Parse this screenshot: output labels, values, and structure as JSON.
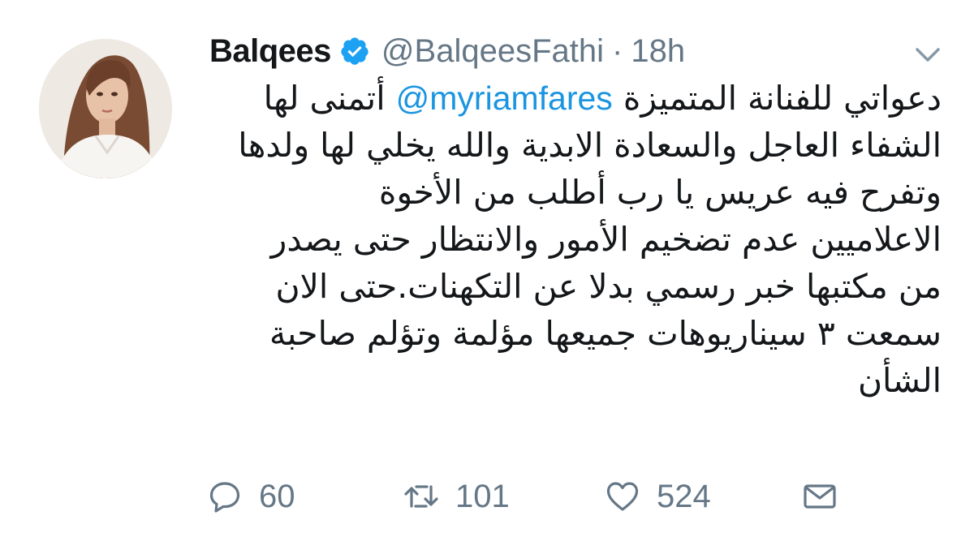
{
  "user": {
    "display_name": "Balqees",
    "handle": "@BalqeesFathi",
    "separator": "·",
    "time_ago": "18h",
    "verified": true,
    "avatar_icon": "profile-photo"
  },
  "tweet": {
    "line1_text": "دعواتي للفنانة المتميزة",
    "line1_mention": "@myriamfares",
    "line1_end": "أتمنى لها",
    "line2": "الشفاء العاجل والسعادة الابدية والله يخلي لها ولدها",
    "line3": "وتفرح فيه عريس يا رب أطلب من الأخوة",
    "line4": "الاعلاميين عدم تضخيم الأمور والانتظار حتى يصدر",
    "line5": "من مكتبها خبر رسمي بدلا عن التكهنات.حتى الان",
    "line6": "سمعت ٣ سيناريوهات جميعها مؤلمة وتؤلم صاحبة",
    "line7": "الشأن"
  },
  "actions": {
    "replies": "60",
    "retweets": "101",
    "likes": "524"
  },
  "colors": {
    "text": "#14171a",
    "muted": "#657786",
    "link": "#1b95e0",
    "verified": "#1da1f2"
  }
}
